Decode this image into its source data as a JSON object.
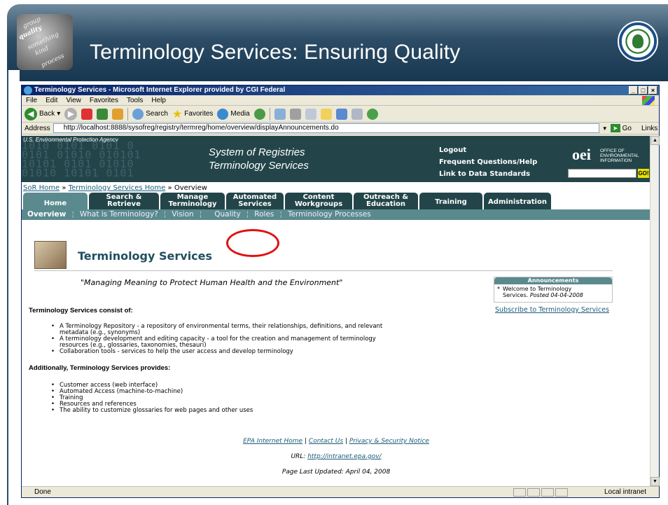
{
  "slide": {
    "title": "Terminology Services: Ensuring Quality",
    "thumb_words": [
      "group",
      "quality",
      "something",
      "kind",
      "process"
    ]
  },
  "browser": {
    "window_title": "Terminology Services - Microsoft Internet Explorer provided by CGI Federal",
    "window_buttons": [
      "_",
      "□",
      "×"
    ],
    "menu": [
      "File",
      "Edit",
      "View",
      "Favorites",
      "Tools",
      "Help"
    ],
    "toolbar": {
      "back": "Back",
      "search": "Search",
      "favorites": "Favorites",
      "media": "Media"
    },
    "address_label": "Address",
    "address_value": "http://localhost:8888/sysofreg/registry/termreg/home/overview/displayAnnouncements.do",
    "go_label": "Go",
    "links_label": "Links",
    "status_text": "Done",
    "zone_text": "Local intranet"
  },
  "site": {
    "agency": "U.S. Environmental Protection Agency",
    "binary_rows": [
      "1010  0101  0101  0",
      "0101 01010 010101",
      "10101 0101 01010",
      "01010 10101 0101"
    ],
    "system_title_1": "System of Registries",
    "system_title_2": "Terminology Services",
    "header_links": [
      "Logout",
      "Frequent Questions/Help",
      "Link to Data Standards"
    ],
    "oei_mark": "oei",
    "oei_text": [
      "OFFICE OF",
      "ENVIRONMENTAL",
      "INFORMATION"
    ],
    "search_go": "GO!"
  },
  "breadcrumb": {
    "home": "SoR Home",
    "sep": "»",
    "services": "Terminology Services Home",
    "current": "Overview"
  },
  "tabs": [
    {
      "l1": "Home",
      "l2": ""
    },
    {
      "l1": "Search &",
      "l2": "Retrieve"
    },
    {
      "l1": "Manage",
      "l2": "Terminology"
    },
    {
      "l1": "Automated",
      "l2": "Services"
    },
    {
      "l1": "Content",
      "l2": "Workgroups"
    },
    {
      "l1": "Outreach &",
      "l2": "Education"
    },
    {
      "l1": "Training",
      "l2": ""
    },
    {
      "l1": "Administration",
      "l2": ""
    }
  ],
  "subnav": [
    "Overview",
    "What is Terminology?",
    "Vision",
    "Quality",
    "Roles",
    "Terminology Processes"
  ],
  "content": {
    "title": "Terminology Services",
    "tagline": "\"Managing Meaning to Protect Human Health and the Environment\"",
    "announcements": {
      "heading": "Announcements",
      "line1": "Welcome to Terminology",
      "line2": "Services.",
      "posted": "Posted 04-04-2008"
    },
    "subscribe": "Subscribe to Terminology Services",
    "consist_heading": "Terminology Services consist of:",
    "consist_items": [
      "A Terminology Repository - a repository of environmental terms, their relationships, definitions, and relevant",
      "metadata (e.g., synonyms)",
      "A terminology development and editing capacity - a tool for the creation and management of terminology",
      "resources (e.g., glossaries, taxonomies, thesauri)",
      "Collaboration tools - services to help the user access and develop terminology"
    ],
    "provides_heading": "Additionally, Terminology Services provides:",
    "provides_items": [
      "Customer access (web interface)",
      "Automated Access (machine-to-machine)",
      "Training",
      "Resources and references",
      "The ability to customize glossaries for web pages and other uses"
    ]
  },
  "footer": {
    "links": [
      "EPA Internet Home",
      "Contact Us",
      "Privacy & Security Notice"
    ],
    "sep": "|",
    "url_label": "URL:",
    "url": "http://intranet.epa.gov/",
    "updated": "Page Last Updated: April 04, 2008"
  }
}
